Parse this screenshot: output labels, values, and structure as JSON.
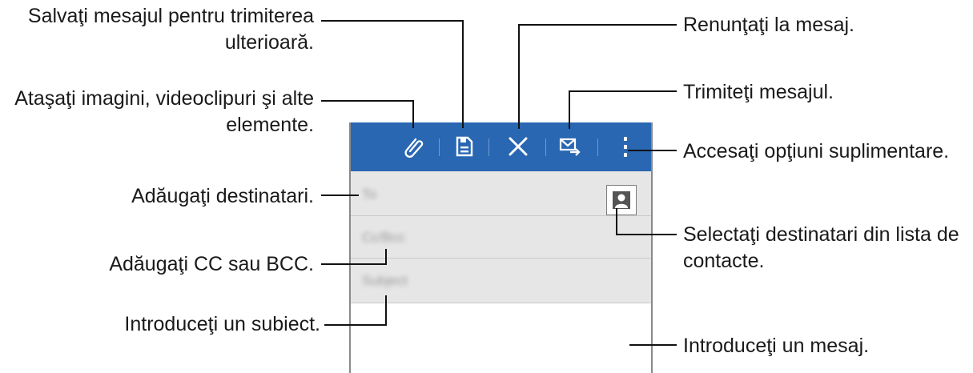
{
  "annotations": {
    "save_for_later": "Salvaţi mesajul pentru trimiterea ulterioară.",
    "attach_files": "Ataşaţi imagini, videoclipuri şi alte elemente.",
    "add_recipients": "Adăugaţi destinatari.",
    "add_cc_bcc": "Adăugaţi CC sau BCC.",
    "enter_subject": "Introduceţi un subiect.",
    "discard_message": "Renunţaţi la mesaj.",
    "send_message": "Trimiteţi mesajul.",
    "more_options": "Accesaţi opţiuni suplimentare.",
    "select_from_contacts": "Selectaţi destinatari din lista de contacte.",
    "enter_message": "Introduceţi un mesaj."
  },
  "compose": {
    "to_placeholder": "To",
    "cc_bcc_placeholder": "Cc/Bcc",
    "subject_placeholder": "Subject"
  },
  "colors": {
    "toolbar": "#2967b2",
    "field_bg": "#e6e6e6"
  },
  "icons": [
    "attach-icon",
    "save-icon",
    "discard-icon",
    "send-icon",
    "more-options-icon",
    "contact-icon"
  ]
}
